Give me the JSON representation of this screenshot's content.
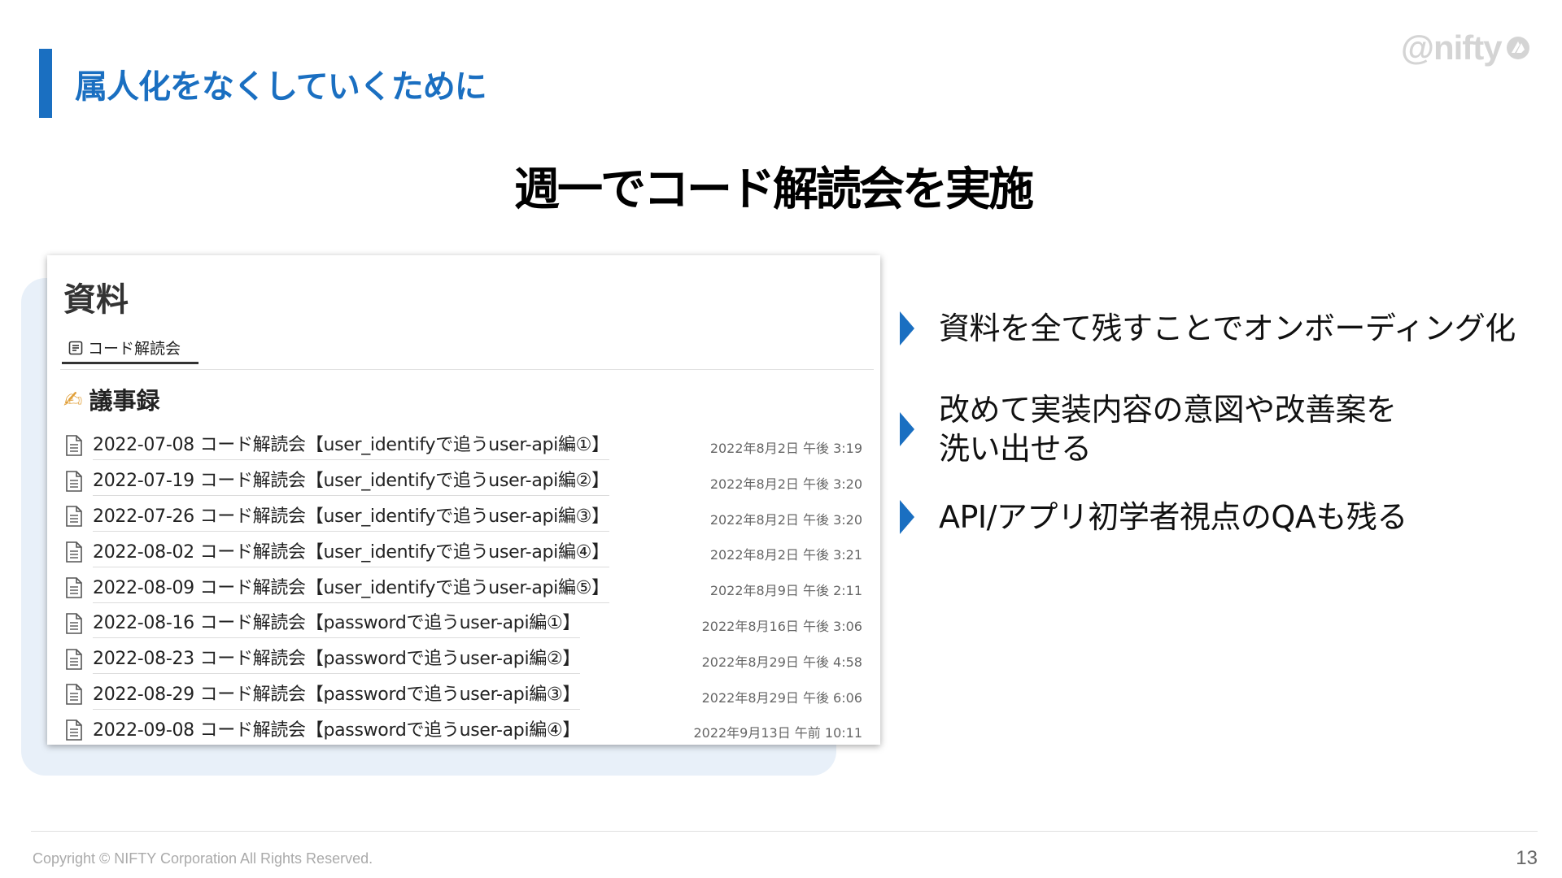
{
  "header": {
    "section_title": "属人化をなくしていくために",
    "logo_text": "@nifty"
  },
  "headline": "週一でコード解読会を実施",
  "screenshot": {
    "title": "資料",
    "tab_label": "コード解読会",
    "section_emoji": "✍",
    "section_title": "議事録",
    "rows": [
      {
        "title": "2022-07-08 コード解読会【user_identifyで追うuser-api編①】",
        "date": "2022年8月2日 午後 3:19"
      },
      {
        "title": "2022-07-19 コード解読会【user_identifyで追うuser-api編②】",
        "date": "2022年8月2日 午後 3:20"
      },
      {
        "title": "2022-07-26 コード解読会【user_identifyで追うuser-api編③】",
        "date": "2022年8月2日 午後 3:20"
      },
      {
        "title": "2022-08-02 コード解読会【user_identifyで追うuser-api編④】",
        "date": "2022年8月2日 午後 3:21"
      },
      {
        "title": "2022-08-09 コード解読会【user_identifyで追うuser-api編⑤】",
        "date": "2022年8月9日 午後 2:11"
      },
      {
        "title": "2022-08-16 コード解読会【passwordで追うuser-api編①】",
        "date": "2022年8月16日 午後 3:06"
      },
      {
        "title": "2022-08-23 コード解読会【passwordで追うuser-api編②】",
        "date": "2022年8月29日 午後 4:58"
      },
      {
        "title": "2022-08-29 コード解読会【passwordで追うuser-api編③】",
        "date": "2022年8月29日 午後 6:06"
      },
      {
        "title": "2022-09-08 コード解読会【passwordで追うuser-api編④】",
        "date": "2022年9月13日 午前 10:11"
      }
    ]
  },
  "bullets": {
    "b1": "資料を全て残すことでオンボーディング化",
    "b2_line1": "改めて実装内容の意図や改善案を",
    "b2_line2": "洗い出せる",
    "b3": "API/アプリ初学者視点のQAも残る"
  },
  "footer": {
    "copyright": "Copyright © NIFTY Corporation All Rights Reserved.",
    "page_number": "13"
  },
  "colors": {
    "accent": "#1a6fc1",
    "card_background": "#e8f0f9"
  }
}
